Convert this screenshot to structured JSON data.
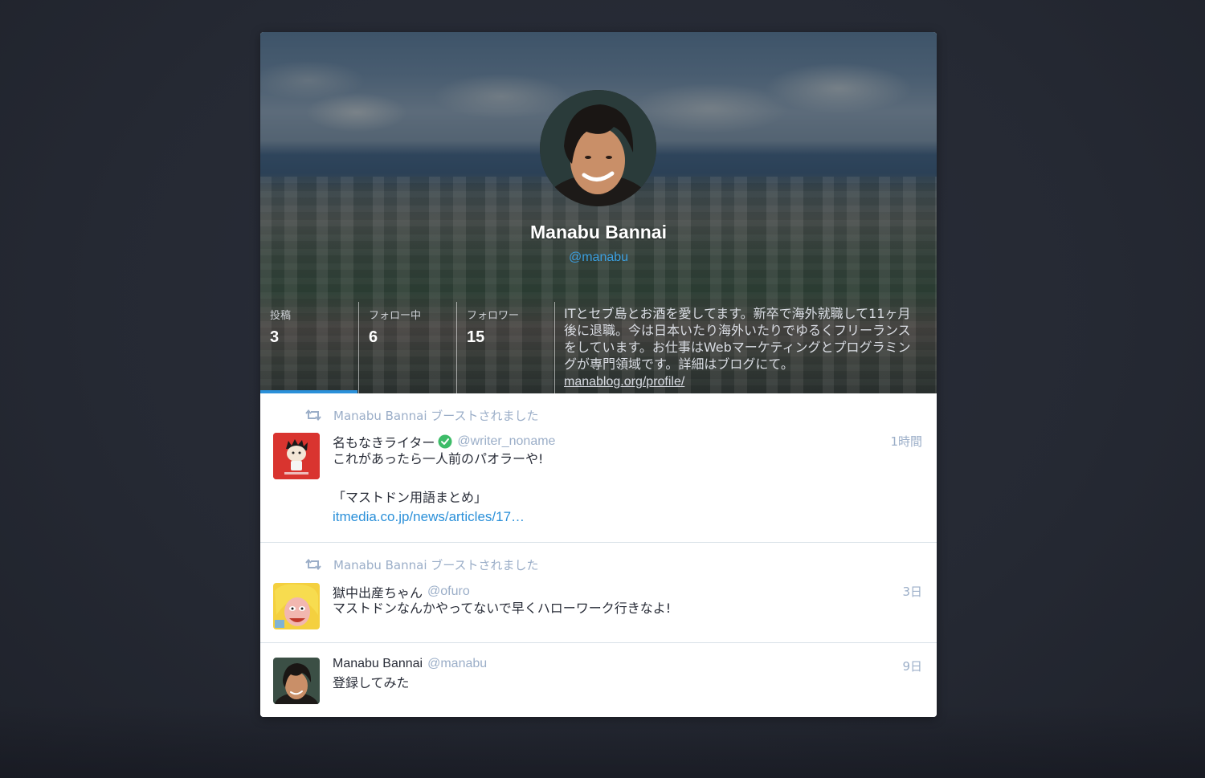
{
  "profile": {
    "display_name": "Manabu Bannai",
    "handle": "@manabu",
    "stats": [
      {
        "label": "投稿",
        "value": "3"
      },
      {
        "label": "フォロー中",
        "value": "6"
      },
      {
        "label": "フォロワー",
        "value": "15"
      }
    ],
    "bio": "ITとセブ島とお酒を愛してます。新卒で海外就職して11ヶ月後に退職。今は日本いたり海外いたりでゆるくフリーランスをしています。お仕事はWebマーケティングとプログラミングが専門領域です。詳細はブログにて。",
    "bio_link": "manablog.org/profile/"
  },
  "timeline": [
    {
      "boost_text": "Manabu Bannai ブーストされました",
      "display_name": "名もなきライター",
      "verified": true,
      "acct": "@writer_noname",
      "time": "1時間",
      "lines": [
        "これがあったら一人前のパオラーや!",
        "",
        "「マストドン用語まとめ」"
      ],
      "link": "itmedia.co.jp/news/articles/17…"
    },
    {
      "boost_text": "Manabu Bannai ブーストされました",
      "display_name": "獄中出産ちゃん",
      "verified": false,
      "acct": "@ofuro",
      "time": "3日",
      "lines": [
        "マストドンなんかやってないで早くハローワーク行きなよ!"
      ]
    },
    {
      "display_name": "Manabu Bannai",
      "acct": "@manabu",
      "time": "9日",
      "lines": [
        "登録してみた"
      ]
    }
  ],
  "colors": {
    "accent": "#2b90d9",
    "muted": "#9baec8",
    "text": "#282c37",
    "background": "#282c37"
  },
  "icons": [
    "boost-icon",
    "verified-check-icon"
  ]
}
